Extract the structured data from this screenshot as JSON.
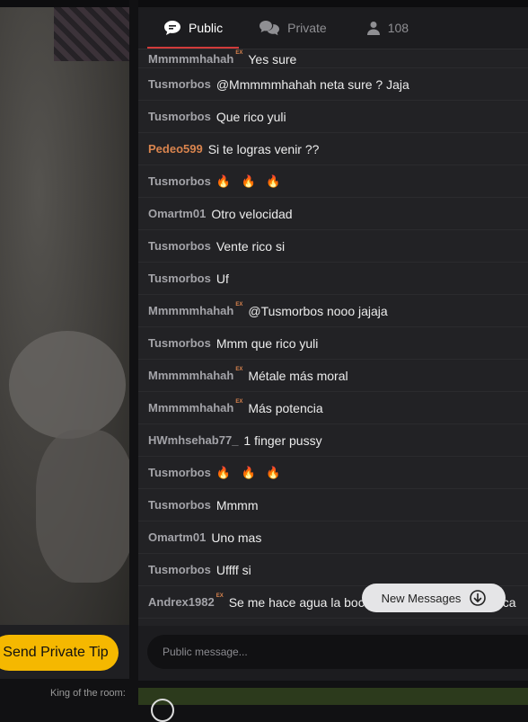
{
  "tabs": [
    {
      "label": "Public",
      "icon": "speech-bubble-icon",
      "active": true
    },
    {
      "label": "Private",
      "icon": "chat-bubbles-icon",
      "active": false
    },
    {
      "label": "108",
      "icon": "user-icon",
      "active": false
    }
  ],
  "messages": [
    {
      "user": "Mmmmmhahah",
      "badge": "EX",
      "text": "Yes sure"
    },
    {
      "user": "Tusmorbos",
      "badge": "",
      "text": "@Mmmmmhahah  neta sure ? Jaja"
    },
    {
      "user": "Tusmorbos",
      "badge": "",
      "text": "Que rico yuli"
    },
    {
      "user": "Pedeo599",
      "badge": "",
      "text": "Si te logras venir ??",
      "highlight": true
    },
    {
      "user": "Tusmorbos",
      "badge": "",
      "text": "🔥 🔥 🔥"
    },
    {
      "user": "Omartm01",
      "badge": "",
      "text": "Otro velocidad"
    },
    {
      "user": "Tusmorbos",
      "badge": "",
      "text": "Vente rico si"
    },
    {
      "user": "Tusmorbos",
      "badge": "",
      "text": "Uf"
    },
    {
      "user": "Mmmmmhahah",
      "badge": "EX",
      "text": "@Tusmorbos  nooo jajaja"
    },
    {
      "user": "Tusmorbos",
      "badge": "",
      "text": "Mmm que rico yuli"
    },
    {
      "user": "Mmmmmhahah",
      "badge": "EX",
      "text": "Métale más moral"
    },
    {
      "user": "Mmmmmhahah",
      "badge": "EX",
      "text": "Más potencia"
    },
    {
      "user": "HWmhsehab77_",
      "badge": "",
      "text": "1 finger pussy"
    },
    {
      "user": "Tusmorbos",
      "badge": "",
      "text": "🔥 🔥 🔥"
    },
    {
      "user": "Tusmorbos",
      "badge": "",
      "text": "Mmmm"
    },
    {
      "user": "Omartm01",
      "badge": "",
      "text": "Uno mas"
    },
    {
      "user": "Tusmorbos",
      "badge": "",
      "text": "Uffff si"
    },
    {
      "user": "Andrex1982",
      "badge": "EX",
      "text": "Se me hace agua la boca y la v3rg4 como una roca"
    }
  ],
  "new_messages_label": "New Messages",
  "input_placeholder": "Public message...",
  "send_tip_label": "Send Private Tip",
  "king_label": "King of the room:",
  "colors": {
    "accent": "#d23b3b",
    "tip_button": "#f5b800",
    "highlight_user": "#d9844e"
  }
}
